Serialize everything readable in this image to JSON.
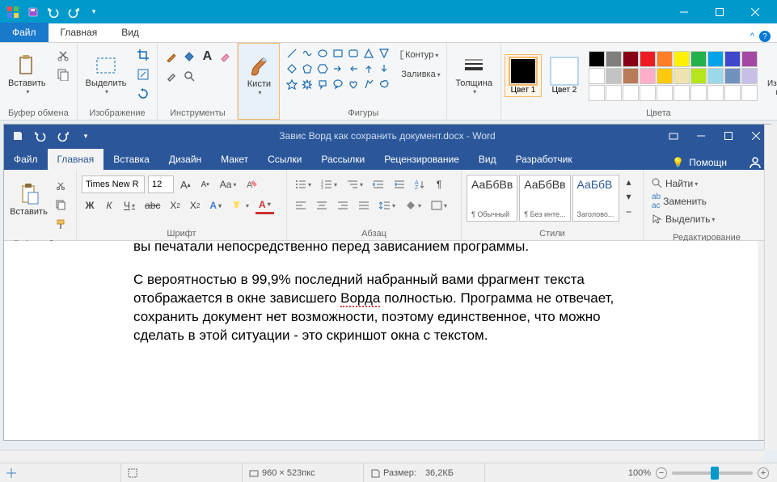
{
  "paint": {
    "tabs": {
      "file": "Файл",
      "home": "Главная",
      "view": "Вид"
    },
    "groups": {
      "clipboard": "Буфер обмена",
      "image": "Изображение",
      "tools": "Инструменты",
      "brushes": "Кисти",
      "shapes": "Фигуры",
      "thickness": "Толщина",
      "color1": "Цвет 1",
      "color2": "Цвет 2",
      "colors": "Цвета",
      "editcolors": "Изменение цветов"
    },
    "buttons": {
      "paste": "Вставить",
      "select": "Выделить",
      "brushes": "Кисти",
      "outline": "Контур",
      "fill": "Заливка",
      "thickness": "Толщина"
    },
    "colors": {
      "primary": "#000000",
      "secondary": "#ffffff",
      "palette_row1": [
        "#000000",
        "#7f7f7f",
        "#880015",
        "#ed1c24",
        "#ff7f27",
        "#fff200",
        "#22b14c",
        "#00a2e8",
        "#3f48cc",
        "#a349a4"
      ],
      "palette_row2": [
        "#ffffff",
        "#c3c3c3",
        "#b97a57",
        "#ffaec9",
        "#ffc90e",
        "#efe4b0",
        "#b5e61d",
        "#99d9ea",
        "#7092be",
        "#c8bfe7"
      ],
      "palette_row3": [
        "#ffffff",
        "#ffffff",
        "#ffffff",
        "#ffffff",
        "#ffffff",
        "#ffffff",
        "#ffffff",
        "#ffffff",
        "#ffffff",
        "#ffffff"
      ]
    },
    "status": {
      "dims": "960 × 523пкс",
      "size_label": "Размер:",
      "size_val": "36,2КБ",
      "zoom": "100%"
    }
  },
  "word": {
    "title": "Завис Ворд как сохранить документ.docx - Word",
    "tabs": {
      "file": "Файл",
      "home": "Главная",
      "insert": "Вставка",
      "design": "Дизайн",
      "layout": "Макет",
      "refs": "Ссылки",
      "mail": "Рассылки",
      "review": "Рецензирование",
      "view": "Вид",
      "dev": "Разработчик",
      "help": "Помощн"
    },
    "ribbon": {
      "paste": "Вставить",
      "clipboard": "Буфер обм...",
      "font_group": "Шрифт",
      "paragraph_group": "Абзац",
      "styles_group": "Стили",
      "editing_group": "Редактирование",
      "font_name": "Times New R",
      "font_size": "12",
      "find": "Найти",
      "replace": "Заменить",
      "select": "Выделить",
      "style1": "АаБбВв",
      "style1_name": "¶ Обычный",
      "style2": "АаБбВв",
      "style2_name": "¶ Без инте...",
      "style3": "АаБбВ",
      "style3_name": "Заголово..."
    },
    "document": {
      "partial_line": "вы печатали непосредственно перед зависанием программы.",
      "para2_a": "С вероятностью в 99,9% последний набранный вами фрагмент текста отображается в окне зависшего ",
      "para2_word": "Ворда",
      "para2_b": " полностью. Программа не отвечает, сохранить документ нет возможности, поэтому единственное, что можно сделать в этой ситуации - это скриншот окна с текстом."
    }
  }
}
